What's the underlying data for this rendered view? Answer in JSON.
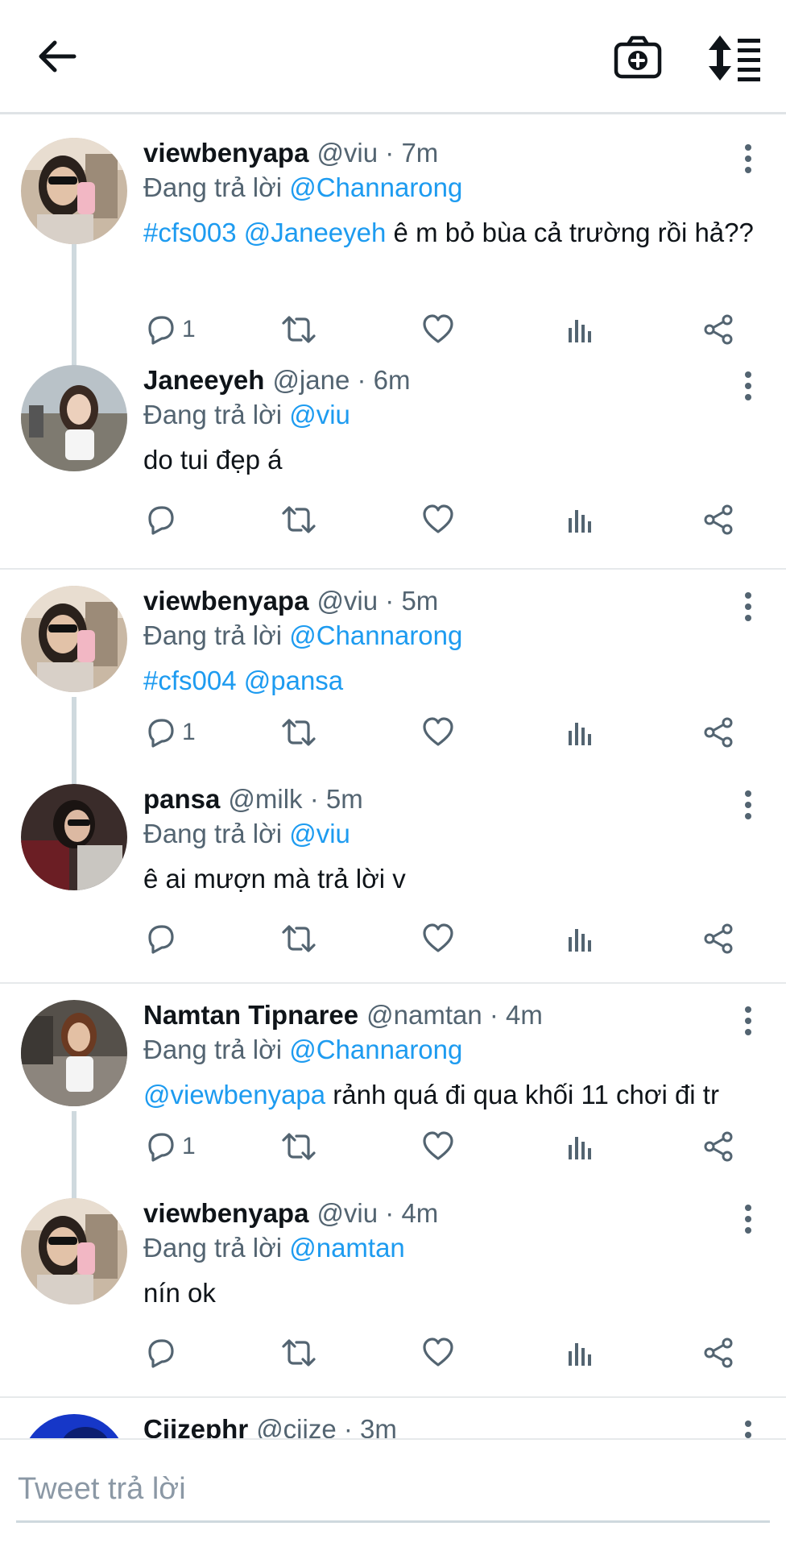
{
  "composer": {
    "placeholder": "Tweet trả lời"
  },
  "threads": [
    {
      "tweets": [
        {
          "name": "viewbenyapa",
          "handle": "@viu · 7m",
          "replying_prefix": "Đang trả lời",
          "replying_to": "@Channarong",
          "body_mentions": "#cfs003 @Janeeyeh",
          "body_text": " ê m bỏ bùa cả trường rồi hả??",
          "reply_count": "1"
        },
        {
          "name": "Janeeyeh",
          "handle": "@jane · 6m",
          "replying_prefix": "Đang trả lời",
          "replying_to": "@viu",
          "body_mentions": "",
          "body_text": "do tui đẹp á",
          "reply_count": ""
        }
      ]
    },
    {
      "tweets": [
        {
          "name": "viewbenyapa",
          "handle": "@viu · 5m",
          "replying_prefix": "Đang trả lời",
          "replying_to": "@Channarong",
          "body_mentions": "#cfs004 @pansa",
          "body_text": "",
          "reply_count": "1"
        },
        {
          "name": "pansa",
          "handle": "@milk · 5m",
          "replying_prefix": "Đang trả lời",
          "replying_to": "@viu",
          "body_mentions": "",
          "body_text": "ê ai mượn mà trả lời v",
          "reply_count": ""
        }
      ]
    },
    {
      "tweets": [
        {
          "name": "Namtan Tipnaree",
          "handle": "@namtan · 4m",
          "replying_prefix": "Đang trả lời",
          "replying_to": "@Channarong",
          "body_mentions": "@viewbenyapa",
          "body_text": " rảnh quá đi qua khối 11 chơi đi tr",
          "reply_count": "1"
        },
        {
          "name": "viewbenyapa",
          "handle": "@viu · 4m",
          "replying_prefix": "Đang trả lời",
          "replying_to": "@namtan",
          "body_mentions": "",
          "body_text": "nín ok",
          "reply_count": ""
        }
      ]
    },
    {
      "tweets": [
        {
          "name": "Cijzephr",
          "handle": "@cijze · 3m",
          "replying_prefix": "",
          "replying_to": "",
          "body_mentions": "",
          "body_text": "",
          "reply_count": ""
        }
      ]
    }
  ],
  "icons": {
    "back": "arrow-left-icon",
    "camera": "camera-plus-icon",
    "sort": "sort-list-icon",
    "more": "more-vertical-icon",
    "reply": "reply-icon",
    "retweet": "retweet-icon",
    "like": "heart-icon",
    "analytics": "analytics-icon",
    "share": "share-icon"
  },
  "colors": {
    "mention": "#1d9bf0",
    "secondary": "#536471",
    "text": "#0f1419"
  }
}
